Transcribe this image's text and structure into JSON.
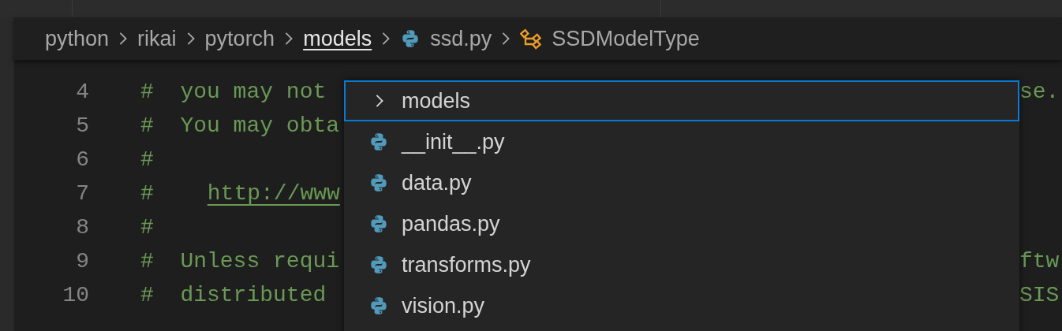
{
  "breadcrumb": [
    {
      "label": "python",
      "kind": "folder",
      "selected": false
    },
    {
      "label": "rikai",
      "kind": "folder",
      "selected": false
    },
    {
      "label": "pytorch",
      "kind": "folder",
      "selected": false
    },
    {
      "label": "models",
      "kind": "folder",
      "selected": true
    },
    {
      "label": "ssd.py",
      "kind": "python",
      "selected": false
    },
    {
      "label": "SSDModelType",
      "kind": "symbol",
      "selected": false
    }
  ],
  "code_lines": [
    {
      "number": "4",
      "text": "#  you may not",
      "tail": "se."
    },
    {
      "number": "5",
      "text": "#  You may obta"
    },
    {
      "number": "6",
      "text": "#"
    },
    {
      "number": "7",
      "text": "#",
      "link": "http://www"
    },
    {
      "number": "8",
      "text": "#"
    },
    {
      "number": "9",
      "text": "#  Unless requi",
      "tail": "ftw"
    },
    {
      "number": "10",
      "text": "#  distributed",
      "tail": "SIS"
    }
  ],
  "dropdown": {
    "items": [
      {
        "label": "models",
        "kind": "folder",
        "selected": true
      },
      {
        "label": "__init__.py",
        "kind": "python",
        "selected": false
      },
      {
        "label": "data.py",
        "kind": "python",
        "selected": false
      },
      {
        "label": "pandas.py",
        "kind": "python",
        "selected": false
      },
      {
        "label": "transforms.py",
        "kind": "python",
        "selected": false
      },
      {
        "label": "vision.py",
        "kind": "python",
        "selected": false
      }
    ]
  }
}
